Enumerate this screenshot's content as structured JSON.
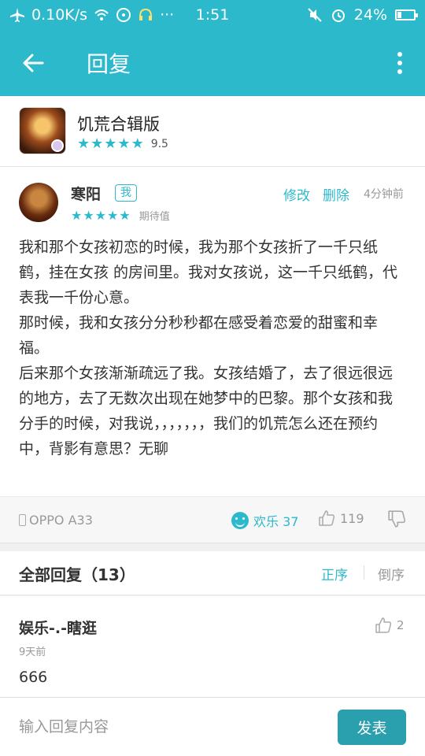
{
  "status_bar": {
    "speed": "0.10K/s",
    "time": "1:51",
    "battery": "24%"
  },
  "header": {
    "title": "回复"
  },
  "game": {
    "name": "饥荒合辑版",
    "rating": "9.5",
    "stars": 5
  },
  "post": {
    "username": "寒阳",
    "me_tag": "我",
    "rating_label": "期待值",
    "edit_label": "修改",
    "delete_label": "删除",
    "time_ago": "4分钟前",
    "paragraphs": [
      "我和那个女孩初恋的时候，我为那个女孩折了一千只纸鹤，挂在女孩 的房间里。我对女孩说，这一千只纸鹤，代表我一千份心意。",
      "那时候，我和女孩分分秒秒都在感受着恋爱的甜蜜和幸福。",
      "后来那个女孩渐渐疏远了我。女孩结婚了，去了很远很远的地方，去了无数次出现在她梦中的巴黎。那个女孩和我分手的时候，对我说，，，，，，，我们的饥荒怎么还在预约中，背影有意思？无聊"
    ],
    "device": "OPPO A33",
    "mood": "欢乐 37",
    "likes": "119"
  },
  "replies": {
    "title": "全部回复（13）",
    "sort_asc": "正序",
    "sort_desc": "倒序",
    "items": [
      {
        "user": "娱乐-.-瞎逛",
        "time": "9天前",
        "text": "666",
        "likes": "2"
      }
    ]
  },
  "input": {
    "placeholder": "输入回复内容",
    "send_label": "发表"
  },
  "colors": {
    "accent": "#2cb9cc",
    "send_button": "#2a9fae"
  }
}
